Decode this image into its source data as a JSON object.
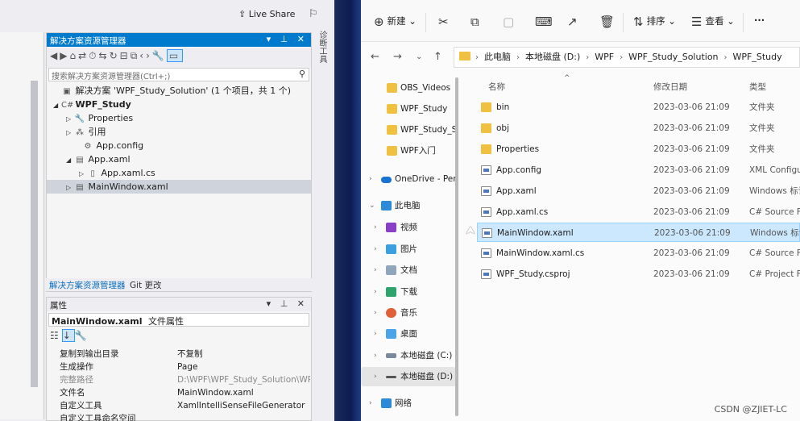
{
  "vs": {
    "live_share": "Live Share",
    "vertical_tab": "诊断工具",
    "solution_explorer": {
      "title": "解决方案资源管理器",
      "search_placeholder": "搜索解决方案资源管理器(Ctrl+;)",
      "items": [
        {
          "label": "解决方案 'WPF_Study_Solution' (1 个项目，共 1 个)",
          "icon": "solution-icon"
        },
        {
          "label": "WPF_Study",
          "icon": "project-icon"
        },
        {
          "label": "Properties",
          "icon": "wrench-icon"
        },
        {
          "label": "引用",
          "icon": "references-icon"
        },
        {
          "label": "App.config",
          "icon": "config-icon"
        },
        {
          "label": "App.xaml",
          "icon": "xaml-icon"
        },
        {
          "label": "App.xaml.cs",
          "icon": "csharp-icon"
        },
        {
          "label": "MainWindow.xaml",
          "icon": "xaml-icon"
        }
      ],
      "tabs": [
        "解决方案资源管理器",
        "Git 更改"
      ]
    },
    "properties": {
      "title": "属性",
      "object_name": "MainWindow.xaml",
      "object_type": "文件属性",
      "rows": [
        {
          "key": "复制到输出目录",
          "value": "不复制"
        },
        {
          "key": "生成操作",
          "value": "Page"
        },
        {
          "key": "完整路径",
          "value": "D:\\WPF\\WPF_Study_Solution\\WPF_S"
        },
        {
          "key": "文件名",
          "value": "MainWindow.xaml"
        },
        {
          "key": "自定义工具",
          "value": "XamlIntelliSenseFileGenerator"
        },
        {
          "key": "自定义工具命名空间",
          "value": ""
        }
      ]
    }
  },
  "explorer": {
    "toolbar": {
      "new": "新建",
      "sort": "排序",
      "view": "查看",
      "more": "···"
    },
    "breadcrumb": [
      "此电脑",
      "本地磁盘 (D:)",
      "WPF",
      "WPF_Study_Solution",
      "WPF_Study"
    ],
    "nav": [
      {
        "label": "OBS_Videos",
        "icon": "folder-icon"
      },
      {
        "label": "WPF_Study",
        "icon": "folder-icon"
      },
      {
        "label": "WPF_Study_Sc",
        "icon": "folder-icon"
      },
      {
        "label": "WPF入门",
        "icon": "folder-icon"
      },
      {
        "label": "OneDrive - Pers",
        "icon": "onedrive-icon"
      },
      {
        "label": "此电脑",
        "icon": "computer-icon"
      },
      {
        "label": "视频",
        "icon": "videos-icon"
      },
      {
        "label": "图片",
        "icon": "pictures-icon"
      },
      {
        "label": "文档",
        "icon": "documents-icon"
      },
      {
        "label": "下载",
        "icon": "downloads-icon"
      },
      {
        "label": "音乐",
        "icon": "music-icon"
      },
      {
        "label": "桌面",
        "icon": "desktop-icon"
      },
      {
        "label": "本地磁盘 (C:)",
        "icon": "drive-icon"
      },
      {
        "label": "本地磁盘 (D:)",
        "icon": "drive-icon"
      },
      {
        "label": "网络",
        "icon": "network-icon"
      }
    ],
    "columns": {
      "name": "名称",
      "date": "修改日期",
      "type": "类型"
    },
    "files": [
      {
        "name": "bin",
        "date": "2023-03-06 21:09",
        "type": "文件夹",
        "kind": "folder"
      },
      {
        "name": "obj",
        "date": "2023-03-06 21:09",
        "type": "文件夹",
        "kind": "folder"
      },
      {
        "name": "Properties",
        "date": "2023-03-06 21:09",
        "type": "文件夹",
        "kind": "folder"
      },
      {
        "name": "App.config",
        "date": "2023-03-06 21:09",
        "type": "XML Configu",
        "kind": "file"
      },
      {
        "name": "App.xaml",
        "date": "2023-03-06 21:09",
        "type": "Windows 标记",
        "kind": "file"
      },
      {
        "name": "App.xaml.cs",
        "date": "2023-03-06 21:09",
        "type": "C# Source Fi",
        "kind": "file"
      },
      {
        "name": "MainWindow.xaml",
        "date": "2023-03-06 21:09",
        "type": "Windows 标记",
        "kind": "file"
      },
      {
        "name": "MainWindow.xaml.cs",
        "date": "2023-03-06 21:09",
        "type": "C# Source Fi",
        "kind": "file"
      },
      {
        "name": "WPF_Study.csproj",
        "date": "2023-03-06 21:09",
        "type": "C# Project Fil",
        "kind": "file"
      }
    ]
  },
  "watermark": "CSDN @ZJIET-LC"
}
